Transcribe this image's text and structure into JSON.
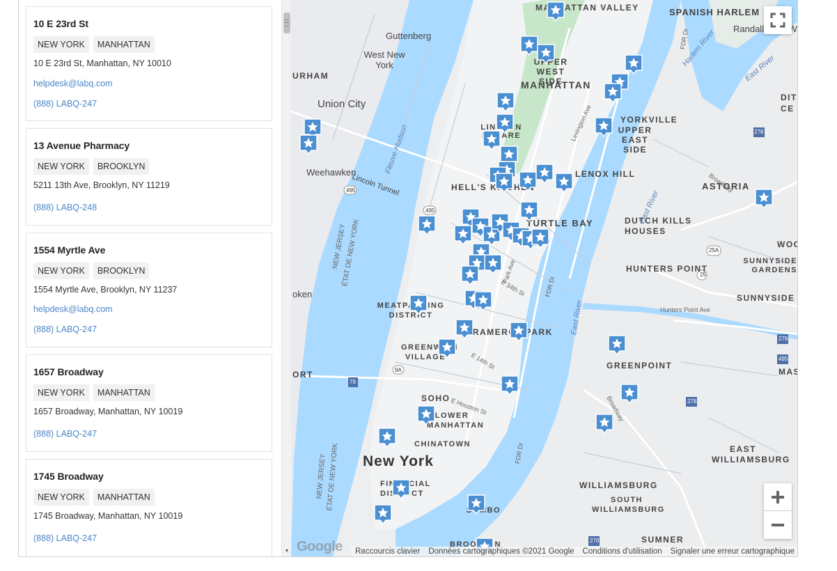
{
  "locations": [
    {
      "name": "10 E 23rd St",
      "tags": [
        "NEW YORK",
        "MANHATTAN"
      ],
      "address": "10 E 23rd St, Manhattan, NY 10010",
      "email": "helpdesk@labq.com",
      "phone": "(888) LABQ-247"
    },
    {
      "name": "13 Avenue Pharmacy",
      "tags": [
        "NEW YORK",
        "BROOKLYN"
      ],
      "address": "5211 13th Ave, Brooklyn, NY 11219",
      "email": "",
      "phone": "(888) LABQ-248"
    },
    {
      "name": "1554 Myrtle Ave",
      "tags": [
        "NEW YORK",
        "BROOKLYN"
      ],
      "address": "1554 Myrtle Ave, Brooklyn, NY 11237",
      "email": "helpdesk@labq.com",
      "phone": "(888) LABQ-247"
    },
    {
      "name": "1657 Broadway",
      "tags": [
        "NEW YORK",
        "MANHATTAN"
      ],
      "address": "1657 Broadway, Manhattan, NY 10019",
      "email": "",
      "phone": "(888) LABQ-247"
    },
    {
      "name": "1745 Broadway",
      "tags": [
        "NEW YORK",
        "MANHATTAN"
      ],
      "address": "1745 Broadway, Manhattan, NY 10019",
      "email": "",
      "phone": "(888) LABQ-247"
    }
  ],
  "map": {
    "labels": {
      "spanish_harlem": "SPANISH HARLEM",
      "randalls": "Randalls and Wards Islands",
      "guttenberg": "Guttenberg",
      "west_new_york": "West New York",
      "upper_west_side": "UPPER WEST SIDE",
      "manhattan": "MANHATTAN",
      "manhattan_valley": "MANHATTAN VALLEY",
      "union_city": "Union City",
      "lincoln_square": "LINCOLN SQUARE",
      "yorkville": "YORKVILLE",
      "upper_east_side": "UPPER EAST SIDE",
      "weehawken": "Weehawken",
      "lincoln_tunnel": "Lincoln Tunnel",
      "hells_kitchen": "HELL'S KITCHEN",
      "lenox_hill": "LENOX HILL",
      "astoria": "ASTORIA",
      "turtle_bay": "TURTLE BAY",
      "dutch_kills": "DUTCH KILLS HOUSES",
      "hunters_point": "HUNTERS POINT",
      "sunnyside_gardens": "SUNNYSIDE GARDENS",
      "sunnyside": "SUNNYSIDE",
      "meatpacking": "MEATPACKING DISTRICT",
      "greenwich": "GREENWICH VILLAGE",
      "gramercy": "GRAMERCY PARK",
      "greenpoint": "GREENPOINT",
      "soho": "SOHO",
      "lower_manhattan": "LOWER MANHATTAN",
      "chinatown": "CHINATOWN",
      "new_york": "New York",
      "east_williamsburg": "EAST WILLIAMSBURG",
      "williamsburg": "WILLIAMSBURG",
      "south_williamsburg": "SOUTH WILLIAMSBURG",
      "financial": "FINANCIAL DISTRICT",
      "dumbo": "DUMBO",
      "brooklyn": "BROOKLYN",
      "sumner": "SUMNER",
      "new_jersey": "NEW JERSEY",
      "etat_new_york": "ÉTAT DE NEW YORK",
      "new_jersey_2": "NEW JERSEY",
      "etat_new_york_2": "ÉTAT DE NEW YORK",
      "fleuve_hudson": "Fleuve Hudson",
      "east_river": "East River",
      "east_river_2": "East River",
      "harlem_river": "Harlem River",
      "east_river_3": "East River",
      "urham": "URHAM",
      "oken": "oken",
      "ort": "ORT",
      "fdr_dr": "FDR Dr",
      "fdr_dr_2": "FDR Dr",
      "fdr_dr_3": "FDR Dr",
      "broadway": "Broadway",
      "broadway_2": "Broadway",
      "hunters_point_ave": "Hunters Point Ave",
      "woo": "WOO",
      "mas": "MAS",
      "e_14th": "E 14th St",
      "e_34th": "E 34th St",
      "e_houston": "E Houston St",
      "park_ave": "Park Ave",
      "lex_ave": "Lexington Ave",
      "dit": "DIT",
      "ce": "CE"
    },
    "roads": [
      "495",
      "495",
      "9A",
      "78",
      "278",
      "278",
      "278",
      "25A",
      "25",
      "495",
      "278"
    ],
    "icons": [
      "fullscreen-icon",
      "plus-icon",
      "minus-icon",
      "star-marker-icon"
    ],
    "attribution": {
      "keyboard": "Raccourcis clavier",
      "data": "Données cartographiques ©2021 Google",
      "terms": "Conditions d'utilisation",
      "report": "Signaler une erreur cartographique"
    },
    "google_logo": "Google"
  },
  "colors": {
    "marker": "#4a8fd2",
    "water": "#aadaff",
    "park": "#c8e6c9",
    "link": "#4a86c8"
  }
}
